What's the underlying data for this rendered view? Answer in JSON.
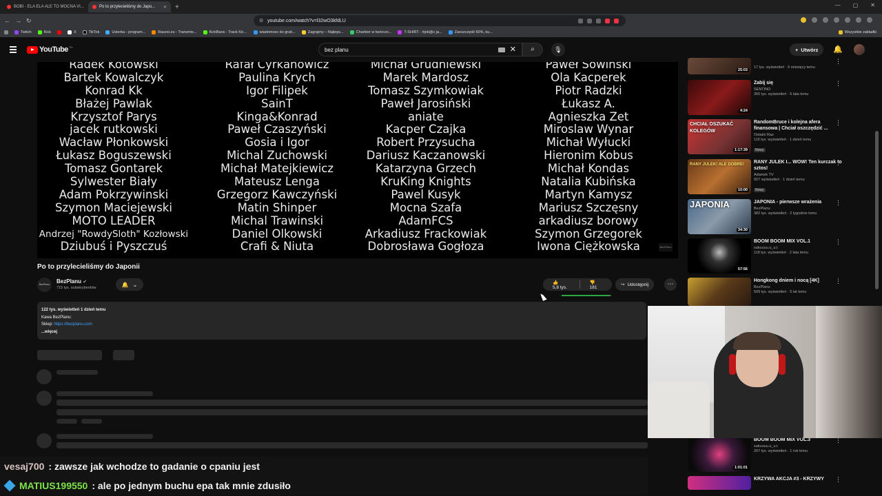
{
  "browser": {
    "tabs": [
      {
        "label": "BOBI - ELA ELA ALE TO MOCNA VI..."
      },
      {
        "label": "Po to przylecieliśmy do Japo..."
      }
    ],
    "url": "youtube.com/watch?v=l32wO3kfdLU",
    "bookmarks": [
      "Twitch",
      "Kick",
      "X",
      "TikTok",
      "Usterka - program...",
      "Raszei.eu - Transmis...",
      "KickBans - Track Kic...",
      "wiadomosc do grub...",
      "Zagrajmy – Najleps...",
      "Charkter w twórczo...",
      "T-SHIRT - #jeb@c ja...",
      "Zaoszczędź 60%, ku..."
    ],
    "all_bookmarks": "Wszystkie zakładki"
  },
  "youtube": {
    "logo": "YouTube",
    "country": "PL",
    "search_value": "bez planu",
    "create_label": "Utwórz"
  },
  "credits": {
    "col1": [
      "Radek Kotowski",
      "Bartek  Kowalczyk",
      "Konrad Kk",
      "Błażej Pawlak",
      "Krzysztof Parys",
      "jacek rutkowski",
      "Wacław Płonkowski",
      "Łukasz Boguszewski",
      "Tomasz Gontarek",
      "Sylwester Biały",
      "Adam Pokrzywinski",
      "Szymon Maciejewski",
      "MOTO LEADER",
      "Andrzej \"RowdySloth\" Kozłowski",
      "Dziubuś i Pyszczuś"
    ],
    "col2": [
      "Rafał Cyrkanowicz",
      "Paulina Krych",
      "Igor Filipek",
      "SainT",
      "Kinga&Konrad",
      "Paweł Czaszyński",
      "Gosia i Igor",
      "Michal Zuchowski",
      "Michał Matejkiewicz",
      "Mateusz Lenga",
      "Grzegorz Kawczyński",
      "Matin Shinper",
      "Michal Trawinski",
      "Daniel Olkowski",
      "Crafi & Niuta"
    ],
    "col3": [
      "Michał Grudniewski",
      "Marek Mardosz",
      "Tomasz Szymkowiak",
      "Paweł Jarosiński",
      "aniate",
      "Kacper Czajka",
      "Robert Przysucha",
      "Dariusz Kaczanowski",
      "Katarzyna Grzech",
      "KruKing Knights",
      "Pawel Kusyk",
      "Mocna Szafa",
      "AdamFCS",
      "Arkadiusz Frackowiak",
      "Dobrosława Gogłoza"
    ],
    "col4": [
      "Paweł Sowiński",
      "Ola Kacperek",
      "Piotr Radzki",
      "Łukasz A.",
      "Agnieszka Zet",
      "Miroslaw Wynar",
      "Michał Wyłucki",
      "Hieronim Kobus",
      "Michał Kondas",
      "Natalia Kubińska",
      "Martyn Kamysz",
      "Mariusz Szczęsny",
      "arkadiusz borowy",
      "Szymon Grzegorek",
      "Iwona Ciężkowska"
    ],
    "watermark": "BezPlanu"
  },
  "video": {
    "title": "Po to przylecieliśmy do Japonii",
    "channel": "BezPlanu",
    "channel_avatar": "BezPlanu",
    "subscribers": "715 tys. subskrybentów",
    "likes": "5,8 tys.",
    "dislikes": "181",
    "like_ratio": 0.97,
    "share_label": "Udostępnij",
    "desc_stats": "122 tys. wyświetleń  1 dzień temu",
    "desc_line1": "Kawa BezPlanu:",
    "desc_shop_label": "Sklep:",
    "desc_shop_link": "https://bezplanu.com",
    "desc_more": "...więcej"
  },
  "sidebar": [
    {
      "title": "",
      "channel": "",
      "meta": "17 tys. wyświetleń · 6 miesięcy temu",
      "duration": "25:03",
      "thumb_text": "",
      "badge": ""
    },
    {
      "title": "Zabij się",
      "channel": "SENTINO",
      "meta": "300 tys. wyświetleń · 5 lata temu",
      "duration": "4:24",
      "thumb_text": "",
      "badge": ""
    },
    {
      "title": "RandomBruce i kolejna afera finansowa | Chciał oszczędzić ...",
      "channel": "Ostatni Raz",
      "meta": "115 tys. wyświetleń · 1 dzień temu",
      "duration": "1:17:39",
      "thumb_text": "CHCIAŁ OSZUKAĆ KOLEGÓW",
      "badge": "Nowy"
    },
    {
      "title": "RANY JULEK I... WOW! Ten kurczak to sztos!",
      "channel": "Adamek TV",
      "meta": "927 wyświetleń · 1 dzień temu",
      "duration": "10:00",
      "thumb_text": "RANY JULEK! ALE DOBRE!",
      "badge": "Nowy"
    },
    {
      "title": "JAPONIA - pierwsze wrażenia",
      "channel": "BezPlanu",
      "meta": "382 tys. wyświetleń · 2 tygodnie temu",
      "duration": "34:30",
      "thumb_text": "JAPONIA",
      "badge": ""
    },
    {
      "title": "BOOM BOOM MIX VOL.1",
      "channel": "sakuuuu.u_u.t",
      "meta": "118 tys. wyświetleń · 2 lata temu",
      "duration": "57:56",
      "thumb_text": "",
      "badge": ""
    },
    {
      "title": "Hongkong dniem i nocą [4K]",
      "channel": "BezPlanu",
      "meta": "509 tys. wyświetleń · 5 lat temu",
      "duration": "",
      "thumb_text": "",
      "badge": ""
    },
    {
      "title": "BOOM BOOM MIX VOL.3",
      "channel": "sakuuuu.u_u.t",
      "meta": "207 tys. wyświetleń · 1 rok temu",
      "duration": "1:01:01",
      "thumb_text": "",
      "badge": ""
    },
    {
      "title": "KRZYWA AKCJA #3 - KRZYWY",
      "channel": "",
      "meta": "",
      "duration": "",
      "thumb_text": "",
      "badge": ""
    }
  ],
  "chat": [
    {
      "user": "vesaj700",
      "msg": ": zawsze jak wchodze to gadanie o cpaniu jest",
      "color": "#d9c3c3"
    },
    {
      "user": "MATIUS199550",
      "msg": ": ale po jednym buchu epa tak mnie zdusiło",
      "color": "#7ee34b"
    }
  ]
}
